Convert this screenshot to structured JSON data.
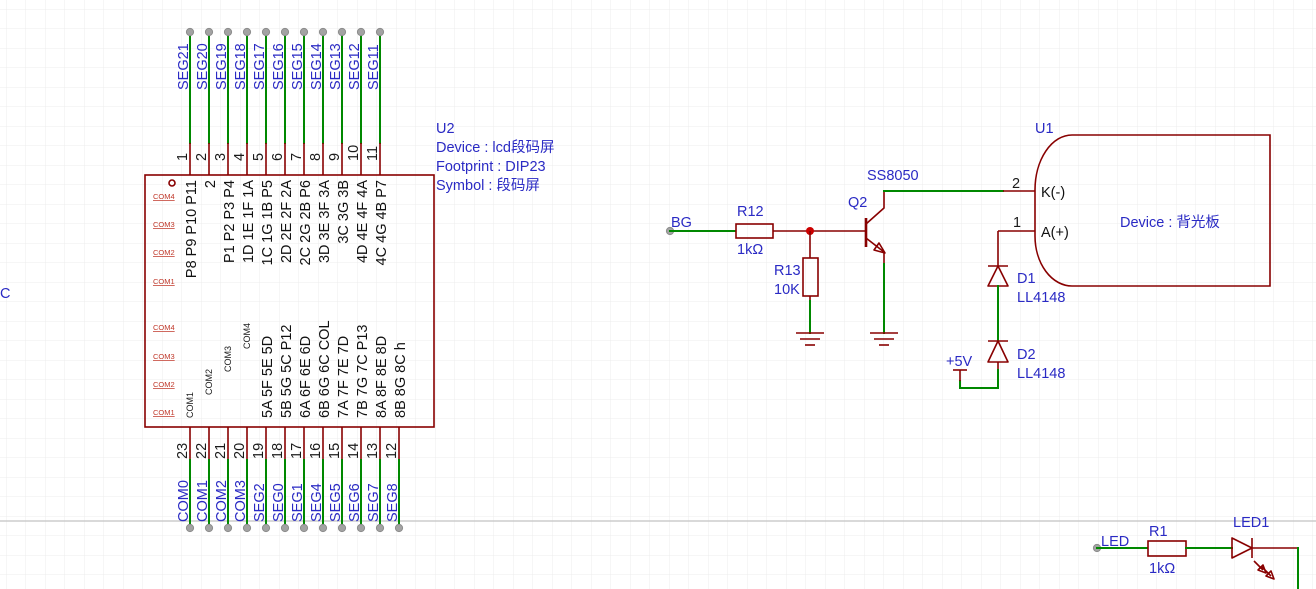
{
  "colors": {
    "wire": "#008800",
    "part": "#880000",
    "net_label": "#2a2ac4",
    "marker": "#c0392b",
    "node": "#a3a3a3",
    "grid": "#ececec",
    "grid_major": "#c2c2c2"
  },
  "canvas": {
    "edge_fragment": "C"
  },
  "u2": {
    "ref": "U2",
    "device": "Device : lcd段码屏",
    "footprint": "Footprint : DIP23",
    "symbol": "Symbol : 段码屏",
    "markers": [
      "COM4",
      "COM3",
      "COM2",
      "COM1",
      "COM4",
      "COM3",
      "COM2",
      "COM1"
    ],
    "top_pins": [
      {
        "num": "1",
        "net": "SEG21",
        "inner": "P8 P9 P10 P11"
      },
      {
        "num": "2",
        "net": "SEG20",
        "inner": "2"
      },
      {
        "num": "3",
        "net": "SEG19",
        "inner": "P1 P2 P3 P4"
      },
      {
        "num": "4",
        "net": "SEG18",
        "inner": "1D 1E 1F 1A"
      },
      {
        "num": "5",
        "net": "SEG17",
        "inner": "1C 1G 1B P5"
      },
      {
        "num": "6",
        "net": "SEG16",
        "inner": "2D 2E 2F 2A"
      },
      {
        "num": "7",
        "net": "SEG15",
        "inner": "2C 2G 2B P6"
      },
      {
        "num": "8",
        "net": "SEG14",
        "inner": "3D 3E 3F 3A"
      },
      {
        "num": "9",
        "net": "SEG13",
        "inner": "3C 3G 3B"
      },
      {
        "num": "10",
        "net": "SEG12",
        "inner": "4D 4E 4F 4A"
      },
      {
        "num": "11",
        "net": "SEG11",
        "inner": "4C 4G 4B P7"
      }
    ],
    "bottom_pins": [
      {
        "num": "23",
        "net": "COM0",
        "inner": "COM1"
      },
      {
        "num": "22",
        "net": "COM1",
        "inner": "COM2"
      },
      {
        "num": "21",
        "net": "COM2",
        "inner": "COM3"
      },
      {
        "num": "20",
        "net": "COM3",
        "inner": "COM4"
      },
      {
        "num": "19",
        "net": "SEG2",
        "inner": "5A 5F 5E 5D"
      },
      {
        "num": "18",
        "net": "SEG0",
        "inner": "5B 5G 5C P12"
      },
      {
        "num": "17",
        "net": "SEG1",
        "inner": "6A 6F 6E 6D"
      },
      {
        "num": "16",
        "net": "SEG4",
        "inner": "6B 6G 6C COL"
      },
      {
        "num": "15",
        "net": "SEG5",
        "inner": "7A 7F 7E 7D"
      },
      {
        "num": "14",
        "net": "SEG6",
        "inner": "7B 7G 7C P13"
      },
      {
        "num": "13",
        "net": "SEG7",
        "inner": "8A 8F 8E 8D"
      },
      {
        "num": "12",
        "net": "SEG8",
        "inner": "8B 8G 8C h"
      }
    ]
  },
  "backlight": {
    "net_in": "BG",
    "r12": {
      "ref": "R12",
      "value": "1kΩ"
    },
    "r13": {
      "ref": "R13",
      "value": "10K"
    },
    "q2": {
      "ref": "Q2",
      "model": "SS8050"
    },
    "u1": {
      "ref": "U1",
      "device": "Device : 背光板",
      "pin_k": {
        "num": "2",
        "name": "K(-)"
      },
      "pin_a": {
        "num": "1",
        "name": "A(+)"
      }
    },
    "d1": {
      "ref": "D1",
      "model": "LL4148"
    },
    "d2": {
      "ref": "D2",
      "model": "LL4148"
    },
    "power": "+5V"
  },
  "led_circuit": {
    "net_in": "LED",
    "r1": {
      "ref": "R1",
      "value": "1kΩ"
    },
    "led1": {
      "ref": "LED1"
    }
  }
}
